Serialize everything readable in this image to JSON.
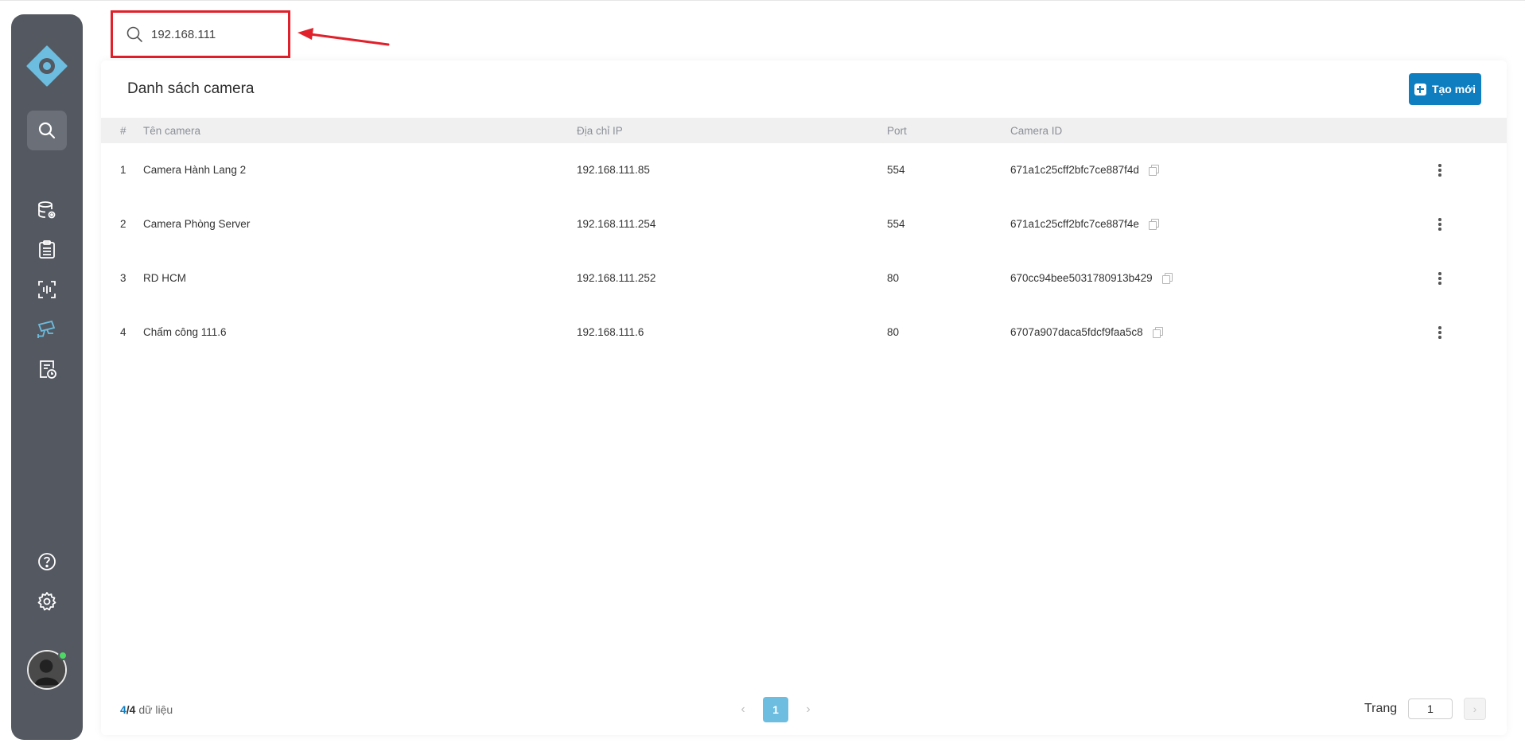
{
  "search": {
    "value": "192.168.111"
  },
  "sidebar": {
    "items": [
      {
        "icon": "search-icon",
        "active": true
      },
      {
        "icon": "database-settings-icon"
      },
      {
        "icon": "clipboard-list-icon"
      },
      {
        "icon": "face-scan-icon"
      },
      {
        "icon": "cctv-camera-icon",
        "highlight": true
      },
      {
        "icon": "report-clock-icon"
      }
    ],
    "bottom": [
      {
        "icon": "help-icon"
      },
      {
        "icon": "settings-icon"
      }
    ],
    "colors": {
      "background": "#545860",
      "accent": "#6cbde0",
      "online": "#4cd964"
    }
  },
  "card": {
    "title": "Danh sách camera",
    "create_label": "Tạo mới",
    "columns": {
      "index": "#",
      "name": "Tên camera",
      "ip": "Địa chỉ IP",
      "port": "Port",
      "camera_id": "Camera ID"
    },
    "rows": [
      {
        "index": "1",
        "name": "Camera Hành Lang 2",
        "ip": "192.168.111.85",
        "port": "554",
        "camera_id": "671a1c25cff2bfc7ce887f4d"
      },
      {
        "index": "2",
        "name": "Camera Phòng Server",
        "ip": "192.168.111.254",
        "port": "554",
        "camera_id": "671a1c25cff2bfc7ce887f4e"
      },
      {
        "index": "3",
        "name": "RD HCM",
        "ip": "192.168.111.252",
        "port": "80",
        "camera_id": "670cc94bee5031780913b429"
      },
      {
        "index": "4",
        "name": "Chấm công 111.6",
        "ip": "192.168.111.6",
        "port": "80",
        "camera_id": "6707a907daca5fdcf9faa5c8"
      }
    ]
  },
  "footer": {
    "shown": "4",
    "total": "/4",
    "suffix": "dữ liệu",
    "current_page": "1",
    "page_label": "Trang",
    "page_input": "1"
  },
  "colors": {
    "primary": "#0e7ec0",
    "highlight_box": "#e0202a"
  }
}
